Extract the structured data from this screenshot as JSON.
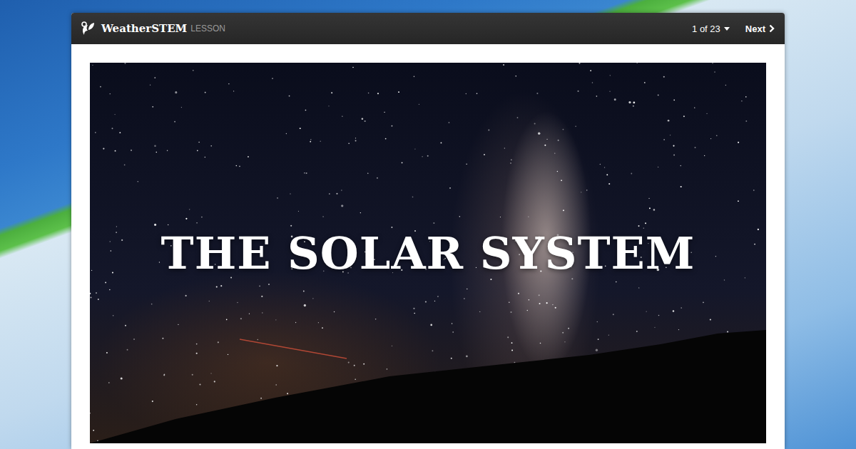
{
  "header": {
    "brand": "WeatherSTEM",
    "section": "LESSON",
    "page_indicator": "1 of 23",
    "next_button": "Next"
  },
  "slide": {
    "title": "THE SOLAR SYSTEM"
  }
}
